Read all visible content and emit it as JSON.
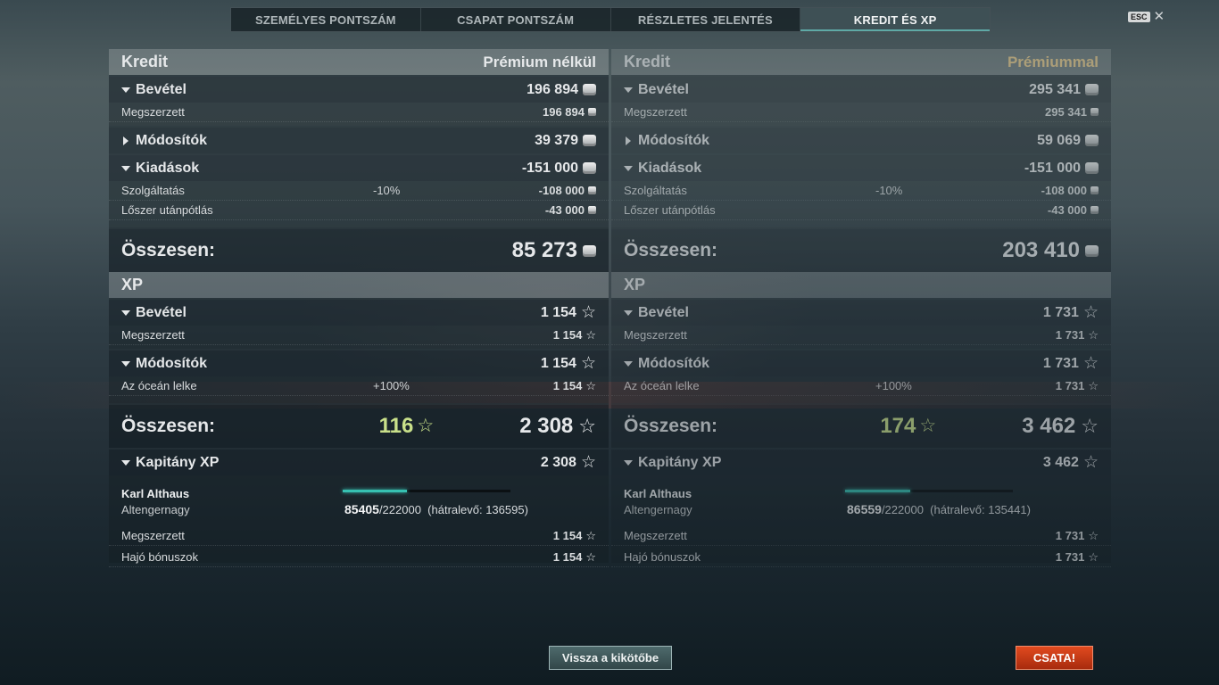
{
  "tabs": [
    {
      "label": "SZEMÉLYES PONTSZÁM",
      "active": false
    },
    {
      "label": "CSAPAT PONTSZÁM",
      "active": false
    },
    {
      "label": "RÉSZLETES JELENTÉS",
      "active": false
    },
    {
      "label": "KREDIT ÉS XP",
      "active": true
    }
  ],
  "esc_label": "ESC",
  "close_symbol": "✕",
  "left": {
    "credit": {
      "header": "Kredit",
      "mode": "Prémium nélkül",
      "income": {
        "label": "Bevétel",
        "value": "196 894"
      },
      "earned": {
        "label": "Megszerzett",
        "value": "196 894"
      },
      "modifiers": {
        "label": "Módosítók",
        "value": "39 379"
      },
      "expenses": {
        "label": "Kiadások",
        "value": "-151 000"
      },
      "service": {
        "label": "Szolgáltatás",
        "pct": "-10%",
        "value": "-108 000"
      },
      "ammo": {
        "label": "Lőszer utánpótlás",
        "value": "-43 000"
      },
      "total": {
        "label": "Összesen:",
        "value": "85 273"
      }
    },
    "xp": {
      "header": "XP",
      "income": {
        "label": "Bevétel",
        "value": "1 154"
      },
      "earned": {
        "label": "Megszerzett",
        "value": "1 154"
      },
      "modifiers": {
        "label": "Módosítók",
        "value": "1 154"
      },
      "ocean": {
        "label": "Az óceán lelke",
        "pct": "+100%",
        "value": "1 154"
      },
      "total": {
        "label": "Összesen:",
        "bonus": "116",
        "value": "2 308"
      },
      "captain": {
        "label": "Kapitány XP",
        "value": "2 308"
      },
      "cap_name": "Karl Althaus",
      "cap_rank": "Altengernagy",
      "progress_fraction": 0.385,
      "cap_current": "85405",
      "cap_total": "/222000",
      "cap_remaining": "(hátralevő: 136595)",
      "cap_earned": {
        "label": "Megszerzett",
        "value": "1 154"
      },
      "ship_bonus": {
        "label": "Hajó bónuszok",
        "value": "1 154"
      }
    }
  },
  "right": {
    "credit": {
      "header": "Kredit",
      "mode": "Prémiummal",
      "income": {
        "label": "Bevétel",
        "value": "295 341"
      },
      "earned": {
        "label": "Megszerzett",
        "value": "295 341"
      },
      "modifiers": {
        "label": "Módosítók",
        "value": "59 069"
      },
      "expenses": {
        "label": "Kiadások",
        "value": "-151 000"
      },
      "service": {
        "label": "Szolgáltatás",
        "pct": "-10%",
        "value": "-108 000"
      },
      "ammo": {
        "label": "Lőszer utánpótlás",
        "value": "-43 000"
      },
      "total": {
        "label": "Összesen:",
        "value": "203 410"
      }
    },
    "xp": {
      "header": "XP",
      "income": {
        "label": "Bevétel",
        "value": "1 731"
      },
      "earned": {
        "label": "Megszerzett",
        "value": "1 731"
      },
      "modifiers": {
        "label": "Módosítók",
        "value": "1 731"
      },
      "ocean": {
        "label": "Az óceán lelke",
        "pct": "+100%",
        "value": "1 731"
      },
      "total": {
        "label": "Összesen:",
        "bonus": "174",
        "value": "3 462"
      },
      "captain": {
        "label": "Kapitány XP",
        "value": "3 462"
      },
      "cap_name": "Karl Althaus",
      "cap_rank": "Altengernagy",
      "progress_fraction": 0.39,
      "cap_current": "86559",
      "cap_total": "/222000",
      "cap_remaining": "(hátralevő: 135441)",
      "cap_earned": {
        "label": "Megszerzett",
        "value": "1 731"
      },
      "ship_bonus": {
        "label": "Hajó bónuszok",
        "value": "1 731"
      }
    }
  },
  "buttons": {
    "port": "Vissza a kikötőbe",
    "battle": "CSATA!"
  }
}
